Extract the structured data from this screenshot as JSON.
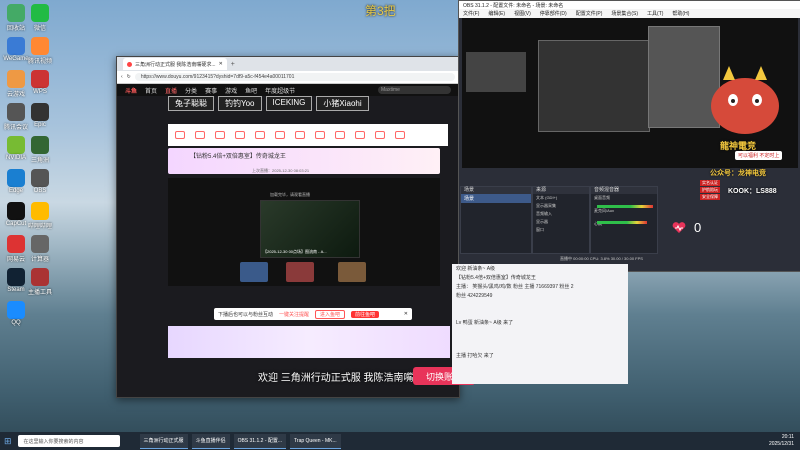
{
  "overlay_label": "第3把",
  "browser": {
    "tab_title": "三角洲行动正式服 我陈浩南嘴硬求...",
    "url": "https://www.douyu.com/9123415?dyshid=7df9-a5c-f454e4a00011701",
    "nav": [
      "首页",
      "直播",
      "分类",
      "赛事",
      "游戏",
      "鱼吧",
      "年度超级节"
    ],
    "logo": "斗鱼",
    "search_placeholder": "Maxtime",
    "banner_names": [
      "兔子聪聪",
      "钓钓Yoo",
      "ICEKING",
      "小猪Xiaohi"
    ],
    "promo_title": "【钻粉5.4倍+双倍惠室】传奇城龙王",
    "promo_sub": "上次直播：2025-12-30 08:03:21",
    "video_caption": "【2025-12-30 00点场】图流南 - A...",
    "video_note": "加载完毕，请观看直播",
    "popup_text": "下播后也可以与粉丝互动",
    "popup_link": "一键关注提醒",
    "popup_btn_a": "进入鱼吧",
    "popup_btn_b": "前往鱼吧",
    "welcome_text": "欢迎  三角洲行动正式服  我陈浩南嘴硬求",
    "switch_label": "切换账号"
  },
  "obs": {
    "title": "OBS 31.1.2 - 配置文件: 未命名 - 场景: 未命名",
    "menu": [
      "文件(F)",
      "编辑(E)",
      "视图(V)",
      "停靠部件(D)",
      "配置文件(P)",
      "场景集合(S)",
      "工具(T)",
      "帮助(H)"
    ],
    "scenes_header": "场景",
    "sources_header": "来源",
    "mixer_header": "音频混音器",
    "scene_item": "场景",
    "source_items": [
      "文本 (GDI+)",
      "显示器采集",
      "音频输入",
      "显示器",
      "窗口"
    ],
    "mixer_items": [
      "桌面音频",
      "麦克风/Aux",
      "心跳"
    ],
    "status": "直播中 00:00:00  CPU: 3.8%  30.00 / 30.00 FPS"
  },
  "longshen": {
    "title": "龍神電竞",
    "sub": "可以福利  不定时上",
    "gzh": "公众号：龙神电竞",
    "kook": "KOOK：LS888",
    "badges": [
      "实名认证",
      "护航陪玩",
      "安全保障"
    ],
    "heart_count": "0"
  },
  "chat": {
    "lines": [
      "欢迎  新油条~  A级",
      "【钻粉5.4倍+双倍惠室】传奇城龙王",
      "主播：   笑猴头/黑鸡/鸡/数 粉丝 主播  71669397  粉丝 2",
      "粉丝  424229549",
      "Lv 鸭蛋  新油条~  A级  来了",
      "主播  打哈欠  来了"
    ]
  },
  "taskbar": {
    "search_placeholder": "在这里输入你要搜索的内容",
    "apps": [
      "三角洲行动正式服",
      "斗鱼直播伴侣",
      "OBS 31.1.2 - 配置...",
      "Trap Queen - MK..."
    ],
    "time": "20:11",
    "date": "2025/12/31"
  },
  "desktop_icons": [
    "回收站",
    "WeGame",
    "云游戏",
    "腾讯会议",
    "NVIDIA",
    "Edge",
    "CapCut",
    "网易云",
    "Steam",
    "QQ",
    "微信",
    "腾讯视频",
    "WPS",
    "Epic",
    "三角洲",
    "OBS",
    "哔哩哔哩",
    "计算器",
    "主播工具"
  ],
  "colors": {
    "accent_red": "#e8345a",
    "obs_dark": "#2b2e38",
    "gold": "#f3c83e"
  }
}
